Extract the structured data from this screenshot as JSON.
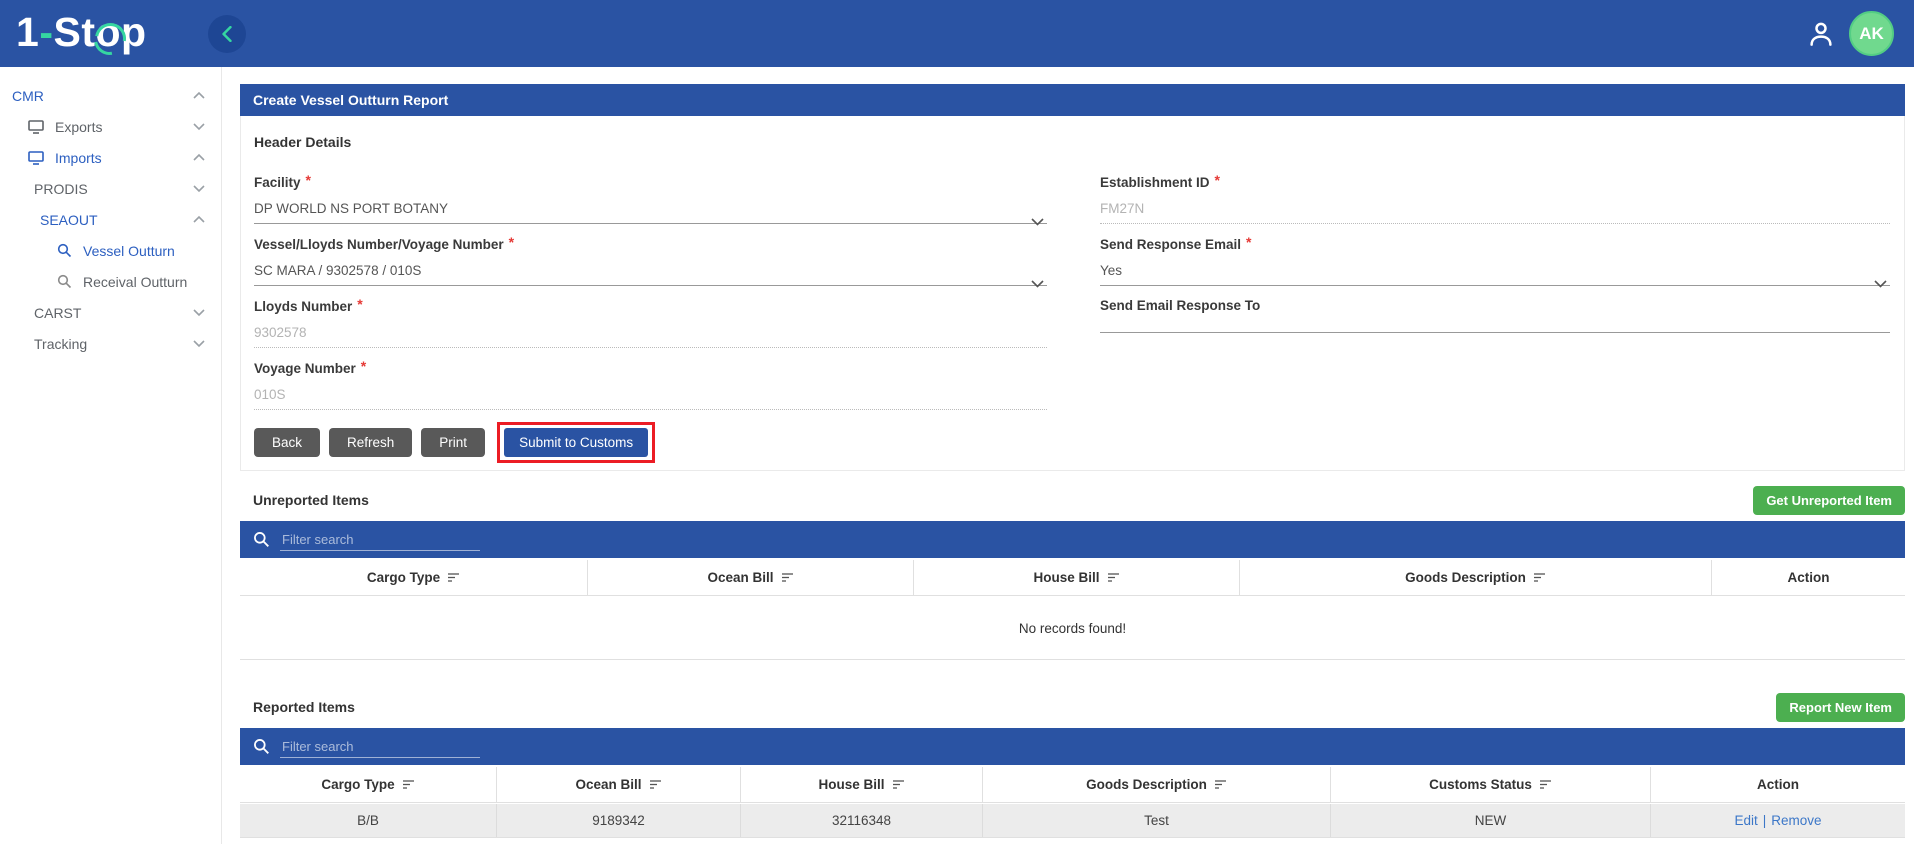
{
  "header": {
    "logo": {
      "part1": "1",
      "dash": "-",
      "part2": "St",
      "o": "o",
      "part3": "p"
    },
    "user_initials": "AK"
  },
  "sidebar": {
    "items": [
      {
        "label": "CMR",
        "active": true,
        "state": "expanded"
      },
      {
        "label": "Exports",
        "active": false,
        "state": "collapsed"
      },
      {
        "label": "Imports",
        "active": true,
        "state": "expanded"
      },
      {
        "label": "PRODIS",
        "active": false,
        "state": "collapsed"
      },
      {
        "label": "SEAOUT",
        "active": true,
        "state": "expanded"
      },
      {
        "label": "Vessel Outturn",
        "active": true,
        "state": "leaf"
      },
      {
        "label": "Receival Outturn",
        "active": false,
        "state": "leaf"
      },
      {
        "label": "CARST",
        "active": false,
        "state": "collapsed"
      },
      {
        "label": "Tracking",
        "active": false,
        "state": "collapsed"
      }
    ]
  },
  "form": {
    "title": "Create Vessel Outturn Report",
    "section_title": "Header Details",
    "required_marker": "*",
    "fields": {
      "facility": {
        "label": "Facility",
        "value": "DP WORLD NS PORT BOTANY",
        "required": true,
        "type": "select"
      },
      "vessel": {
        "label": "Vessel/Lloyds Number/Voyage Number",
        "value": "SC MARA / 9302578 / 010S",
        "required": true,
        "type": "select"
      },
      "lloyds": {
        "label": "Lloyds Number",
        "value": "9302578",
        "required": true,
        "type": "disabled"
      },
      "voyage": {
        "label": "Voyage Number",
        "value": "010S",
        "required": true,
        "type": "disabled"
      },
      "establishment": {
        "label": "Establishment ID",
        "value": "FM27N",
        "required": true,
        "type": "disabled"
      },
      "send_response": {
        "label": "Send Response Email",
        "value": "Yes",
        "required": true,
        "type": "select"
      },
      "send_email_to": {
        "label": "Send Email Response To",
        "value": "",
        "required": false,
        "type": "text"
      }
    },
    "buttons": {
      "back": "Back",
      "refresh": "Refresh",
      "print": "Print",
      "submit": "Submit to Customs"
    }
  },
  "unreported": {
    "title": "Unreported Items",
    "action_button": "Get Unreported Item",
    "filter_placeholder": "Filter search",
    "columns": [
      "Cargo Type",
      "Ocean Bill",
      "House Bill",
      "Goods Description",
      "Action"
    ],
    "empty_message": "No records found!"
  },
  "reported": {
    "title": "Reported Items",
    "action_button": "Report New Item",
    "filter_placeholder": "Filter search",
    "columns": [
      "Cargo Type",
      "Ocean Bill",
      "House Bill",
      "Goods Description",
      "Customs Status",
      "Action"
    ],
    "action_separator": "|",
    "rows": [
      {
        "cargo_type": "B/B",
        "ocean_bill": "9189342",
        "house_bill": "32116348",
        "goods_description": "Test",
        "customs_status": "NEW",
        "actions": [
          "Edit",
          "Remove"
        ]
      }
    ]
  },
  "colors": {
    "primary_blue": "#2a53a3",
    "accent_teal": "#35d6a1",
    "green_button": "#4caf50",
    "avatar_green": "#70d98e",
    "dark_button": "#595959",
    "highlight_red": "#ec1c24",
    "required_red": "#e53935",
    "active_link_blue": "#2c5fc0",
    "action_link_blue": "#3c77c8"
  }
}
